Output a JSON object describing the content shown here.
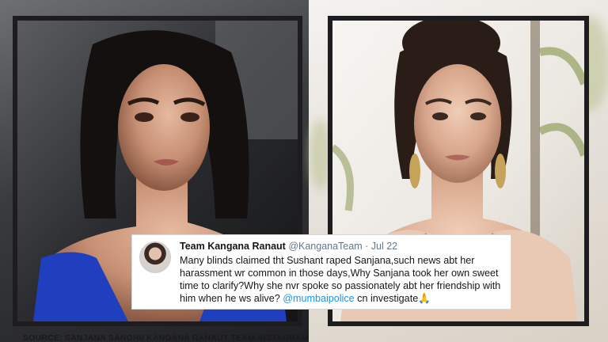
{
  "tweet": {
    "author": "Team Kangana Ranaut",
    "handle": "@KanganaTeam",
    "separator": "·",
    "date": "Jul 22",
    "text_before": "Many blinds claimed tht Sushant raped Sanjana,such news abt her harassment wr common in those days,Why Sanjana took her own sweet time to clarify?Why she nvr spoke so passionately abt her friendship with him when he ws alive? ",
    "mention": "@mumbaipolice",
    "text_after": " cn investigate",
    "emoji": "🙏"
  },
  "source_caption": "SOURCE: SANJANA SANGHI/ KANGANA RANAUT TEAM INSTAGRAM",
  "icons": {
    "avatar": "profile-avatar",
    "left_photo": "portrait-photo-sanjana",
    "right_photo": "portrait-photo-kangana"
  },
  "colors": {
    "frame": "#1d1d1f",
    "mention": "#1b95e0",
    "handle": "#657786",
    "left_dress": "#1f3fbf",
    "right_dress": "#e9c9b4"
  }
}
